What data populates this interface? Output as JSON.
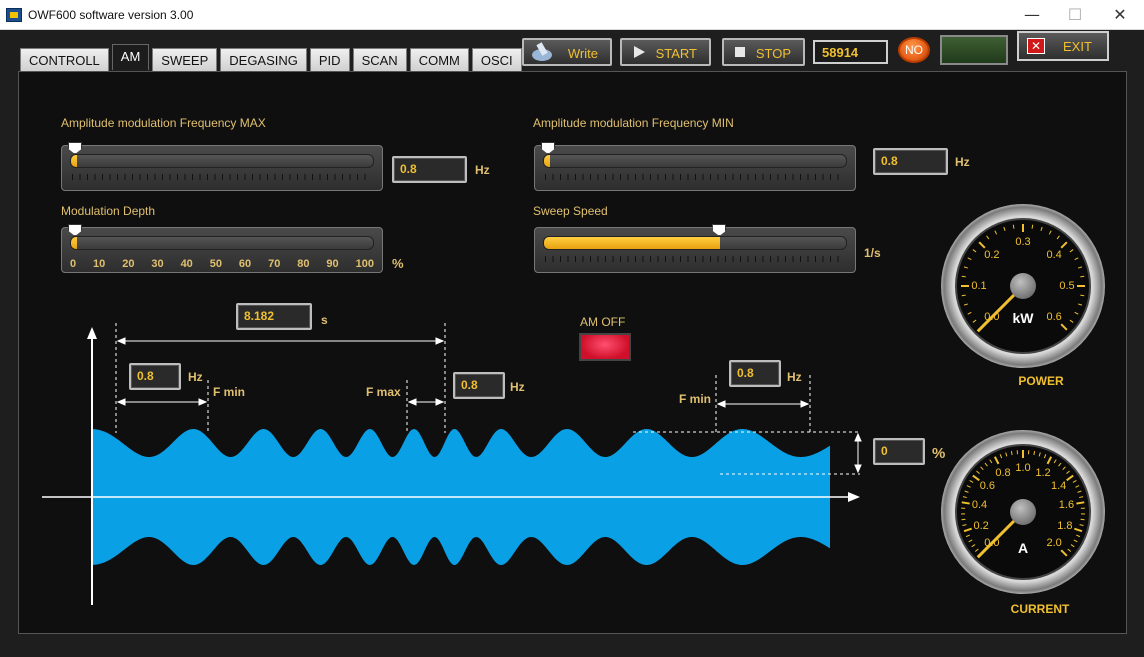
{
  "window": {
    "title": "OWF600 software version 3.00",
    "minimize": "—",
    "maximize": "☐",
    "close": "✕"
  },
  "tabs": [
    "CONTROLL",
    "AM",
    "SWEEP",
    "DEGASING",
    "PID",
    "SCAN",
    "COMM",
    "OSCI"
  ],
  "active_tab": "AM",
  "toolbar": {
    "write_label": "Write",
    "start_label": "START",
    "stop_label": "STOP",
    "counter_value": "58914",
    "no_label": "NO",
    "exit_label": "EXIT"
  },
  "am_freq_max": {
    "label": "Amplitude modulation Frequency MAX",
    "value": "0.8",
    "unit": "Hz",
    "level": 0
  },
  "am_freq_min": {
    "label": "Amplitude modulation Frequency MIN",
    "value": "0.8",
    "unit": "Hz",
    "level": 0
  },
  "mod_depth": {
    "label": "Modulation Depth",
    "unit": "%",
    "scale": [
      "0",
      "10",
      "20",
      "30",
      "40",
      "50",
      "60",
      "70",
      "80",
      "90",
      "100"
    ],
    "level": 0
  },
  "sweep_speed": {
    "label": "Sweep Speed",
    "unit": "1/s",
    "level": 0.58
  },
  "diagram": {
    "period_value": "8.182",
    "period_unit": "s",
    "fmin_left_value": "0.8",
    "fmin_left_unit": "Hz",
    "fmin_left_label": "F min",
    "fmax_value": "0.8",
    "fmax_unit": "Hz",
    "fmax_label": "F max",
    "fmin_right_value": "0.8",
    "fmin_right_unit": "Hz",
    "fmin_right_label": "F min",
    "depth_value": "0",
    "depth_unit": "%",
    "am_status_label": "AM OFF"
  },
  "power_gauge": {
    "title": "POWER",
    "unit": "kW",
    "ticks": [
      "0.0",
      "0.1",
      "0.2",
      "0.3",
      "0.4",
      "0.5",
      "0.6"
    ],
    "value": 0.0
  },
  "current_gauge": {
    "title": "CURRENT",
    "unit": "A",
    "ticks": [
      "0.0",
      "0.2",
      "0.4",
      "0.6",
      "0.8",
      "1.0",
      "1.2",
      "1.4",
      "1.6",
      "1.8",
      "2.0"
    ],
    "value": 0.0
  },
  "colors": {
    "waveform": "#0aa0e6",
    "accent": "#f0c030",
    "led_red": "#e0183a",
    "led_orange": "#e8601a"
  }
}
